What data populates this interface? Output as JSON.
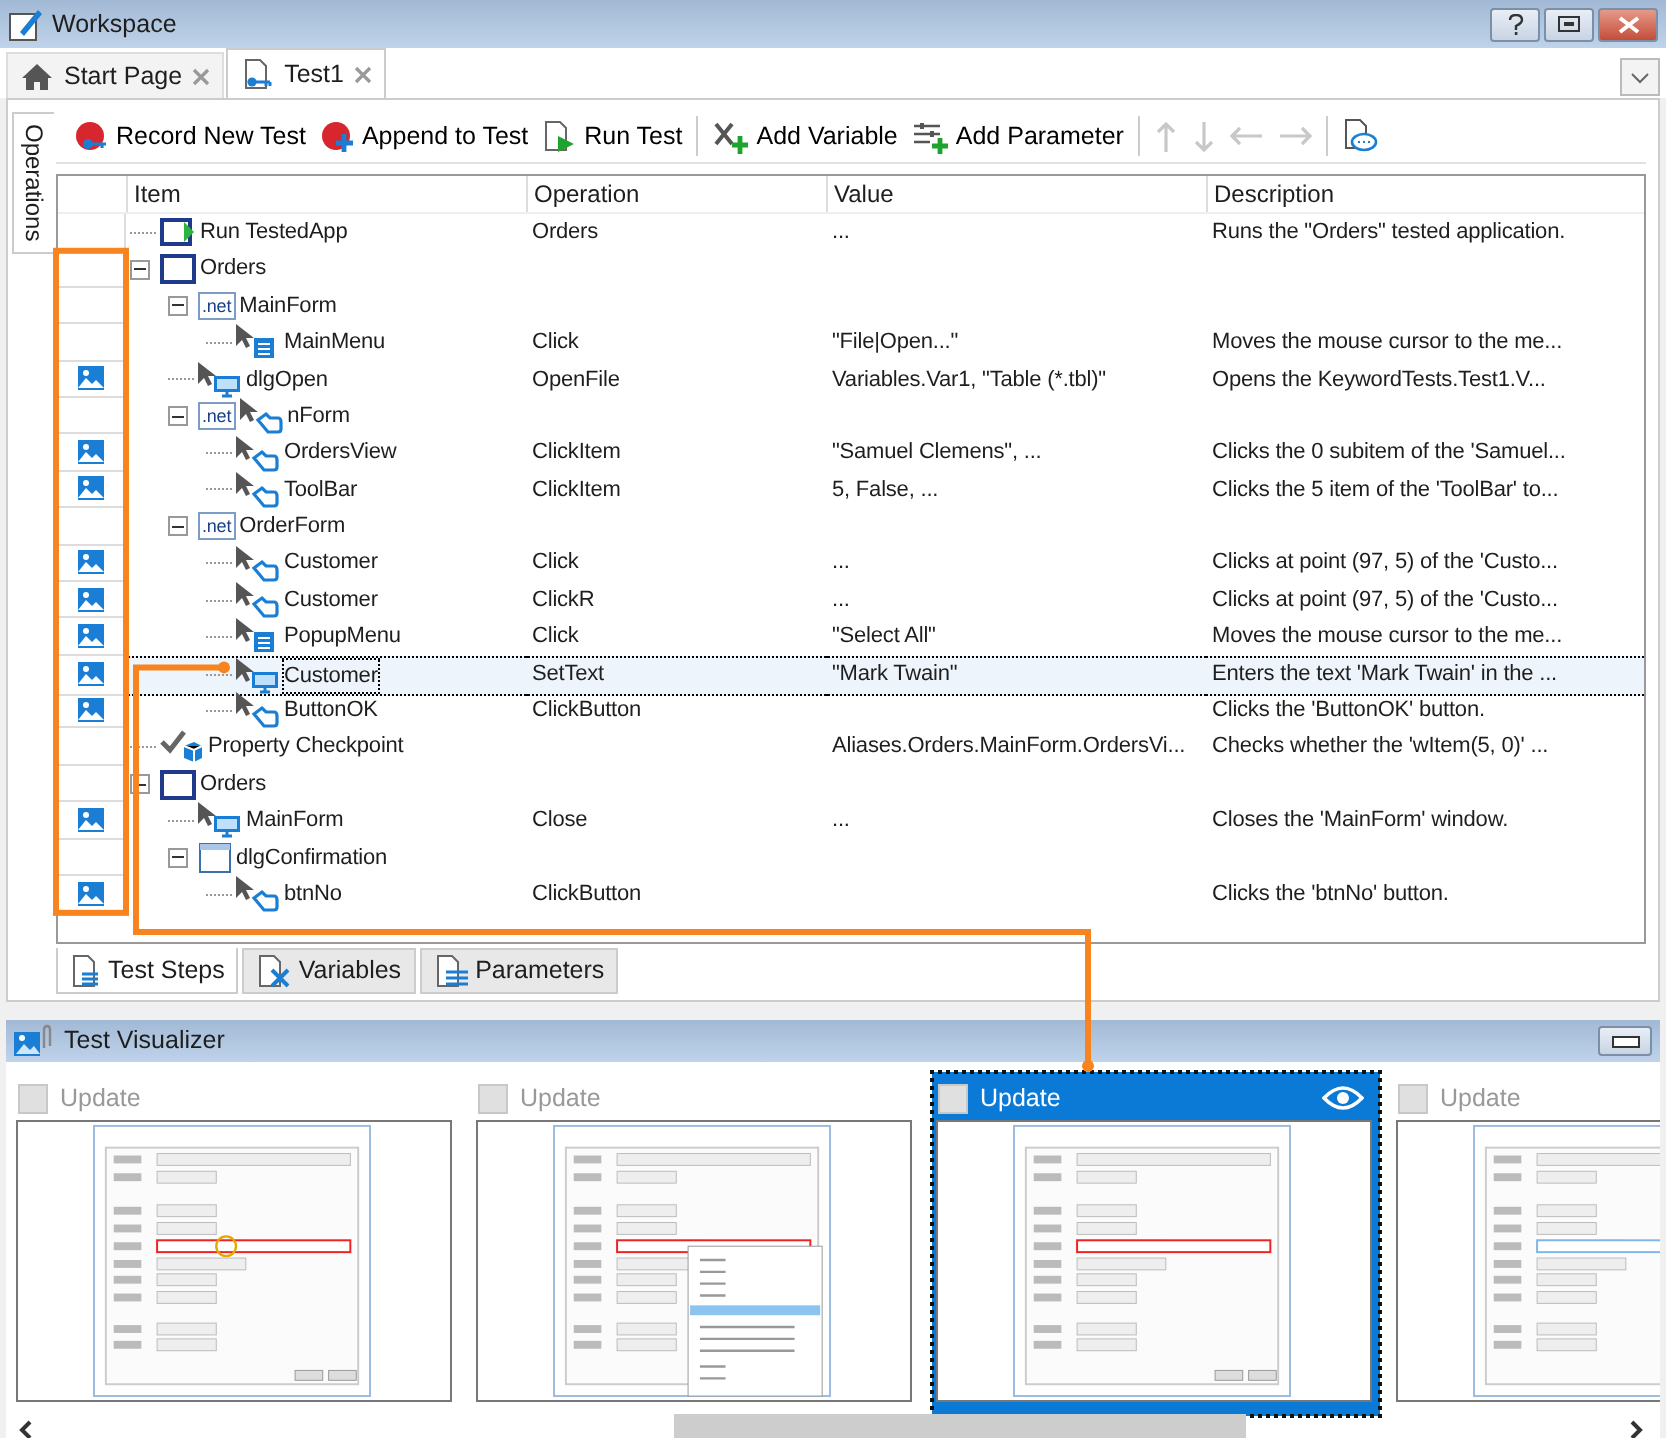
{
  "window": {
    "title": "Workspace"
  },
  "doc_tabs": [
    {
      "label": "Start Page",
      "kind": "home",
      "selected": false
    },
    {
      "label": "Test1",
      "kind": "test",
      "selected": true
    }
  ],
  "side_tabs": [
    {
      "label": "Operations",
      "selected": true
    }
  ],
  "toolbar": [
    {
      "kind": "record",
      "label": "Record New Test"
    },
    {
      "kind": "append",
      "label": "Append to Test"
    },
    {
      "kind": "run",
      "label": "Run Test"
    },
    {
      "kind": "separator"
    },
    {
      "kind": "variable",
      "label": "Add Variable"
    },
    {
      "kind": "parameter",
      "label": "Add Parameter"
    },
    {
      "kind": "separator"
    },
    {
      "kind": "up",
      "disabled": true
    },
    {
      "kind": "down",
      "disabled": true
    },
    {
      "kind": "left",
      "disabled": true
    },
    {
      "kind": "right",
      "disabled": true
    },
    {
      "kind": "separator"
    },
    {
      "kind": "comment",
      "disabled": false
    }
  ],
  "grid": {
    "columns": [
      "Item",
      "Operation",
      "Value",
      "Description"
    ],
    "rows": [
      {
        "item": "Run TestedApp",
        "kind": "run",
        "operation": "Orders",
        "value": "...",
        "description": "Runs the \"Orders\" tested application.",
        "has_screenshot": false,
        "selected": false
      },
      {
        "item": "Orders",
        "kind": "window",
        "has_screenshot": false,
        "selected": false,
        "expanded": true,
        "children": [
          {
            "item": "MainForm",
            "kind": "net",
            "icon_text": ".net",
            "has_screenshot": false,
            "selected": false,
            "expanded": true,
            "children": [
              {
                "item": "MainMenu",
                "kind": "menu",
                "operation": "Click",
                "value": "\"File|Open...\"",
                "description": "Moves the mouse cursor to the me...",
                "has_screenshot": false,
                "selected": false
              }
            ]
          },
          {
            "item": "dlgOpen",
            "kind": "screen",
            "operation": "OpenFile",
            "value": "Variables.Var1, \"Table (*.tbl)\"",
            "description": "Opens the KeywordTests.Test1.V...",
            "has_screenshot": true,
            "selected": false
          },
          {
            "item": "nForm",
            "kind": "net-hand",
            "icon_text": ".net",
            "has_screenshot": false,
            "selected": false,
            "expanded": true,
            "children": [
              {
                "item": "OrdersView",
                "kind": "hand",
                "operation": "ClickItem",
                "value": "\"Samuel Clemens\", ...",
                "description": "Clicks the 0 subitem of the 'Samuel...",
                "has_screenshot": true,
                "selected": false
              },
              {
                "item": "ToolBar",
                "kind": "hand",
                "operation": "ClickItem",
                "value": "5, False, ...",
                "description": "Clicks the 5 item of the 'ToolBar' to...",
                "has_screenshot": true,
                "selected": false
              }
            ]
          },
          {
            "item": "OrderForm",
            "kind": "net",
            "icon_text": ".net",
            "has_screenshot": false,
            "selected": false,
            "expanded": true,
            "children": [
              {
                "item": "Customer",
                "kind": "hand",
                "operation": "Click",
                "value": "...",
                "description": "Clicks at point (97, 5) of the 'Custo...",
                "has_screenshot": true,
                "selected": false
              },
              {
                "item": "Customer",
                "kind": "hand",
                "operation": "ClickR",
                "value": "...",
                "description": "Clicks at point (97, 5) of the 'Custo...",
                "has_screenshot": true,
                "selected": false
              },
              {
                "item": "PopupMenu",
                "kind": "menu",
                "operation": "Click",
                "value": "\"Select All\"",
                "description": "Moves the mouse cursor to the me...",
                "has_screenshot": true,
                "selected": false
              },
              {
                "item": "Customer",
                "kind": "screen",
                "operation": "SetText",
                "value": "\"Mark Twain\"",
                "description": "Enters the text 'Mark Twain' in the ...",
                "has_screenshot": true,
                "selected": true
              },
              {
                "item": "ButtonOK",
                "kind": "hand",
                "operation": "ClickButton",
                "description": "Clicks the 'ButtonOK' button.",
                "has_screenshot": true,
                "selected": false
              }
            ]
          }
        ]
      },
      {
        "item": "Property Checkpoint",
        "kind": "checkpoint",
        "value": "Aliases.Orders.MainForm.OrdersVi...",
        "description": "Checks whether the 'wItem(5, 0)' ...",
        "has_screenshot": false,
        "selected": false
      },
      {
        "item": "Orders",
        "kind": "window",
        "has_screenshot": false,
        "selected": false,
        "expanded": true,
        "children": [
          {
            "item": "MainForm",
            "kind": "screen",
            "operation": "Close",
            "value": "...",
            "description": "Closes the 'MainForm' window.",
            "has_screenshot": true,
            "selected": false
          },
          {
            "item": "dlgConfirmation",
            "kind": "dialog",
            "has_screenshot": false,
            "selected": false,
            "expanded": true,
            "children": [
              {
                "item": "btnNo",
                "kind": "hand",
                "operation": "ClickButton",
                "description": "Clicks the 'btnNo' button.",
                "has_screenshot": true,
                "selected": false
              }
            ]
          }
        ]
      }
    ]
  },
  "bottom_tabs": [
    {
      "label": "Test Steps",
      "kind": "steps",
      "selected": true
    },
    {
      "label": "Variables",
      "kind": "variables",
      "selected": false
    },
    {
      "label": "Parameters",
      "kind": "parameters",
      "selected": false
    }
  ],
  "visualizer": {
    "title": "Test Visualizer",
    "frames": [
      {
        "label": "Update",
        "checked": false,
        "selected": false,
        "kind": "click"
      },
      {
        "label": "Update",
        "checked": false,
        "selected": false,
        "kind": "menu"
      },
      {
        "label": "Update",
        "checked": false,
        "selected": true,
        "kind": "typing"
      },
      {
        "label": "Update",
        "checked": false,
        "selected": false,
        "kind": "typed"
      }
    ]
  }
}
